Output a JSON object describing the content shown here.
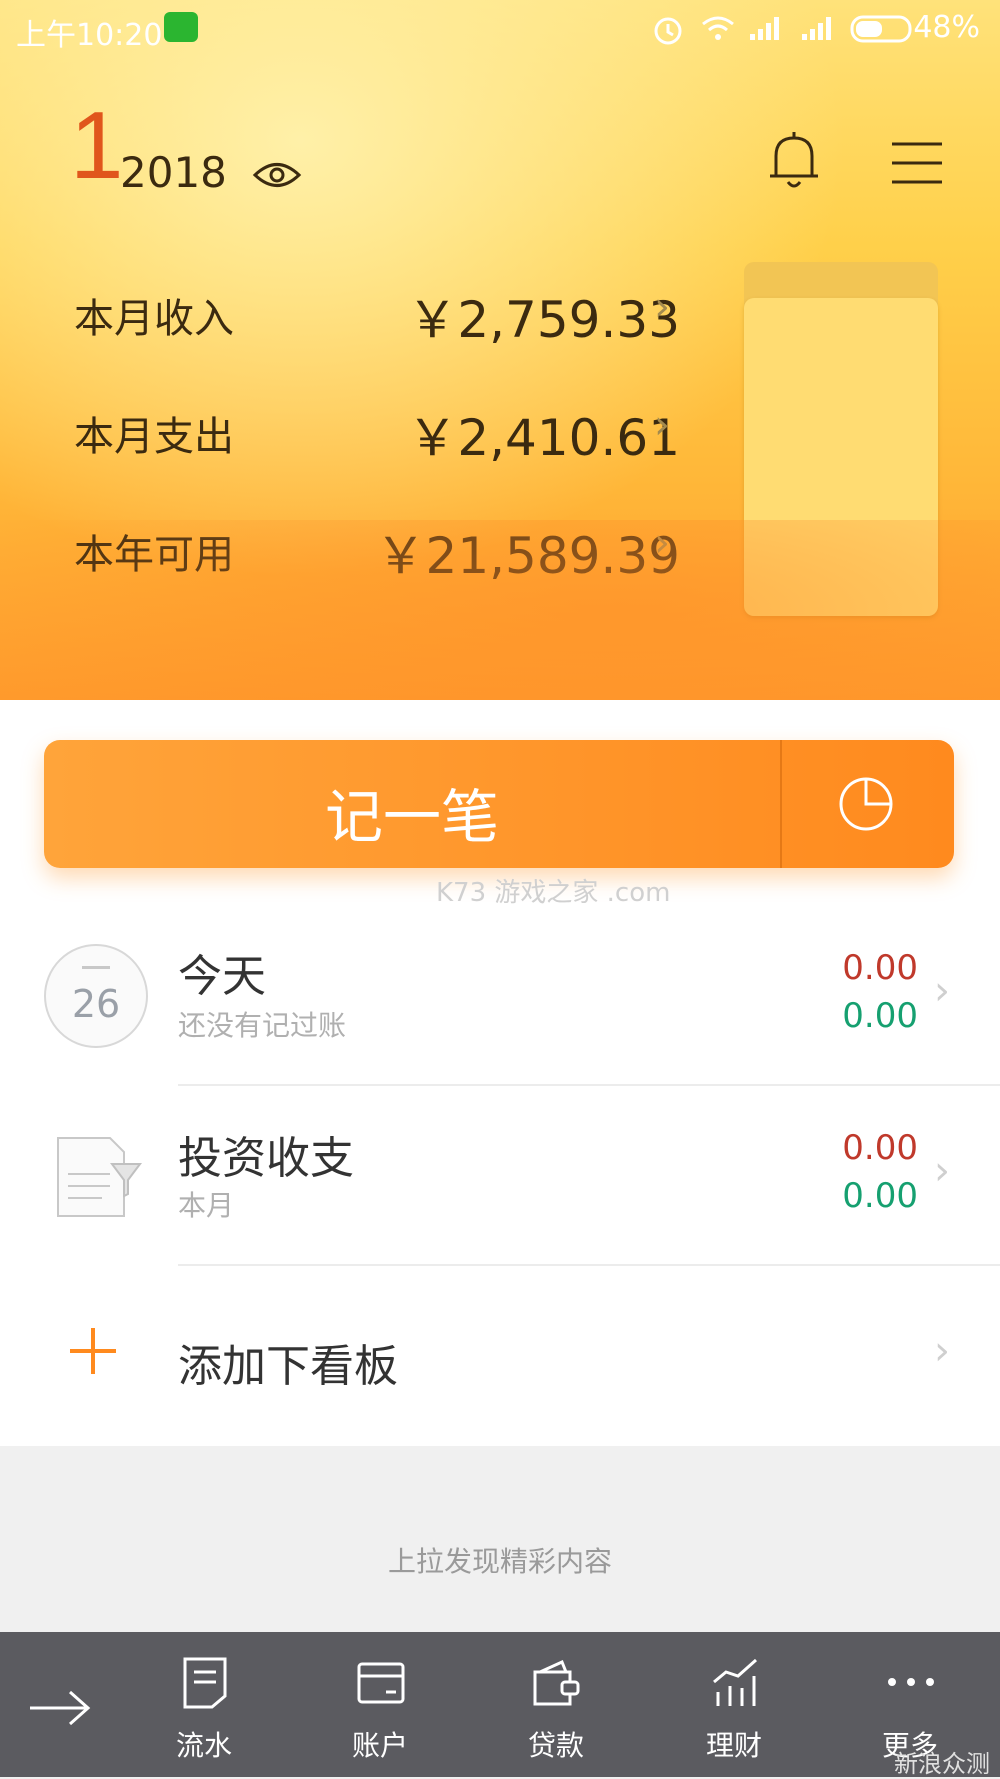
{
  "status_bar": {
    "time": "上午10:20",
    "battery": "48%",
    "icons": [
      "wechat-icon",
      "alarm-icon",
      "wifi-icon",
      "signal-icon",
      "signal-icon",
      "battery-icon"
    ]
  },
  "header": {
    "month": "1",
    "year": "2018",
    "rows": [
      {
        "label": "本月收入",
        "amount": "￥2,759.33"
      },
      {
        "label": "本月支出",
        "amount": "￥2,410.61"
      },
      {
        "label": "本年可用",
        "amount": "￥21,589.39"
      }
    ]
  },
  "record_button": {
    "label": "记一笔"
  },
  "watermark": "K73 游戏之家 .com",
  "boards": [
    {
      "title": "今天",
      "subtitle": "还没有记过账",
      "calendar_day": "26",
      "income": "0.00",
      "expense": "0.00"
    },
    {
      "title": "投资收支",
      "subtitle": "本月",
      "income": "0.00",
      "expense": "0.00"
    }
  ],
  "add_board": {
    "label": "添加下看板"
  },
  "pull_up_hint": "上拉发现精彩内容",
  "bottom_nav": {
    "items": [
      {
        "label": "流水",
        "icon": "note-icon"
      },
      {
        "label": "账户",
        "icon": "card-icon"
      },
      {
        "label": "贷款",
        "icon": "wallet-icon"
      },
      {
        "label": "理财",
        "icon": "chart-icon"
      },
      {
        "label": "更多",
        "icon": "more-icon"
      }
    ]
  },
  "corner_watermark": "新浪众测",
  "colors": {
    "accent": "#ff9a2c",
    "income_red": "#c0392b",
    "expense_green": "#16a070",
    "nav_bg": "#5b5b60"
  }
}
